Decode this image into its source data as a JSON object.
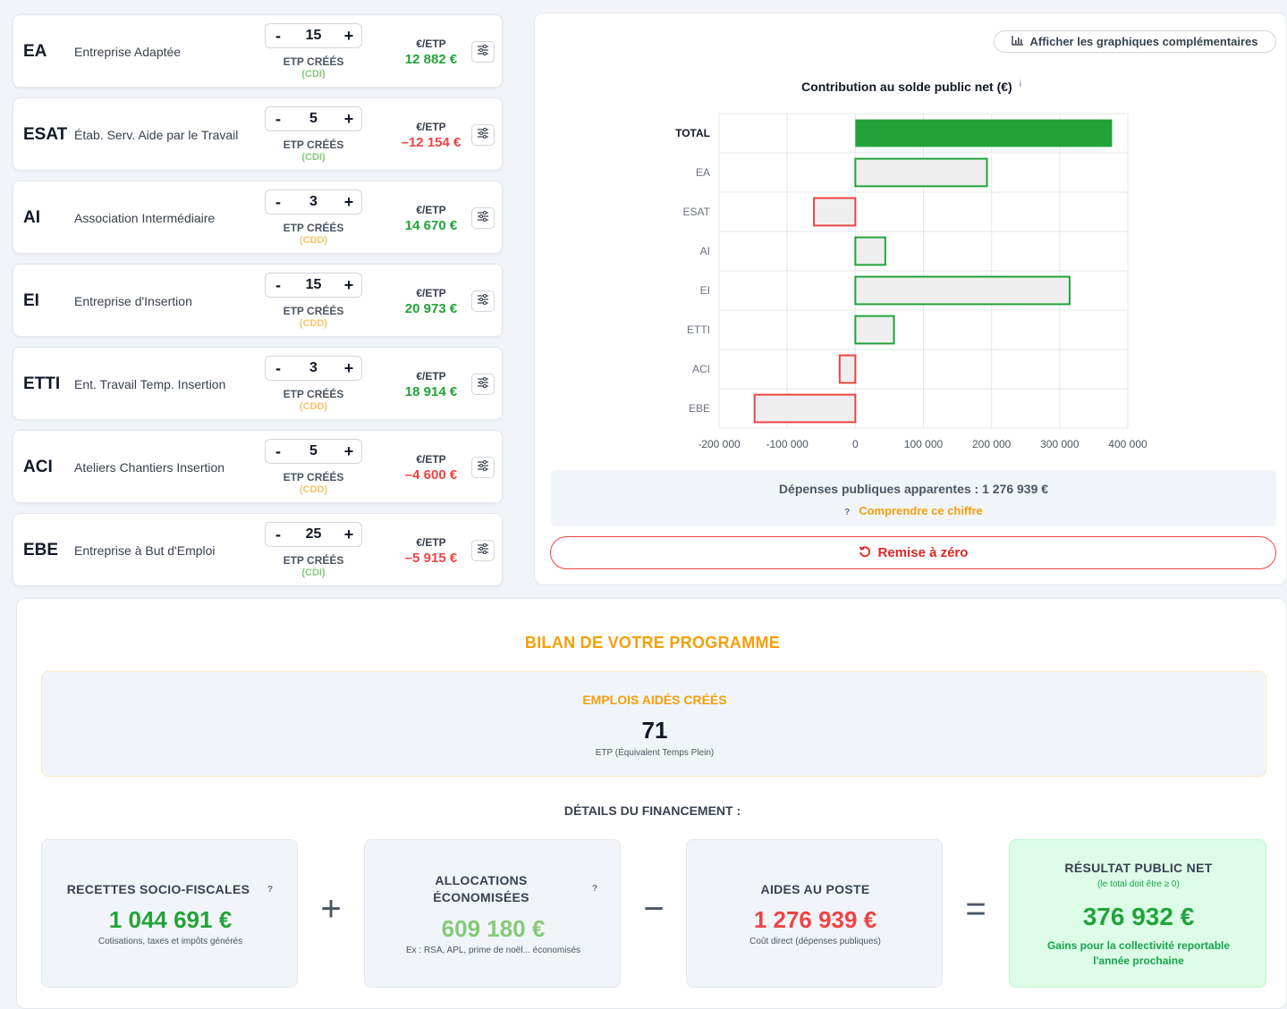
{
  "programs": [
    {
      "abbr": "EA",
      "name": "Entreprise Adaptée",
      "count": "15",
      "etp_label": "ETP CRÉÉS",
      "contract": "(CDI)",
      "per_label": "€/ETP",
      "per_value": "12 882 €",
      "positive": true
    },
    {
      "abbr": "ESAT",
      "name": "Étab. Serv. Aide par le Travail",
      "count": "5",
      "etp_label": "ETP CRÉÉS",
      "contract": "(CDI)",
      "per_label": "€/ETP",
      "per_value": "–12 154 €",
      "positive": false
    },
    {
      "abbr": "AI",
      "name": "Association Intermédiaire",
      "count": "3",
      "etp_label": "ETP CRÉÉS",
      "contract": "(CDD)",
      "per_label": "€/ETP",
      "per_value": "14 670 €",
      "positive": true
    },
    {
      "abbr": "EI",
      "name": "Entreprise d'Insertion",
      "count": "15",
      "etp_label": "ETP CRÉÉS",
      "contract": "(CDD)",
      "per_label": "€/ETP",
      "per_value": "20 973 €",
      "positive": true
    },
    {
      "abbr": "ETTI",
      "name": "Ent. Travail Temp. Insertion",
      "count": "3",
      "etp_label": "ETP CRÉÉS",
      "contract": "(CDD)",
      "per_label": "€/ETP",
      "per_value": "18 914 €",
      "positive": true
    },
    {
      "abbr": "ACI",
      "name": "Ateliers Chantiers Insertion",
      "count": "5",
      "etp_label": "ETP CRÉÉS",
      "contract": "(CDD)",
      "per_label": "€/ETP",
      "per_value": "–4 600 €",
      "positive": false
    },
    {
      "abbr": "EBE",
      "name": "Entreprise à But d'Emploi",
      "count": "25",
      "etp_label": "ETP CRÉÉS",
      "contract": "(CDI)",
      "per_label": "€/ETP",
      "per_value": "–5 915 €",
      "positive": false
    }
  ],
  "stepper": {
    "minus": "-",
    "plus": "+"
  },
  "colors": {
    "positive": "#22a33a",
    "negative": "#ef4444",
    "cdi": "#86c97a",
    "cdd": "#f5c36b",
    "accent": "#f59e0b",
    "bar_total": "#22a33a",
    "bar_fill": "#eeeeee"
  },
  "chart_panel": {
    "graph_toggle": "Afficher les graphiques complémentaires",
    "title": "Contribution au solde public net (€)",
    "info": "i",
    "depenses": "Dépenses publiques apparentes : 1 276 939 €",
    "help_mark": "?",
    "comprendre": "Comprendre ce chiffre",
    "reset": "Remise à zéro"
  },
  "chart_data": {
    "type": "bar",
    "orientation": "horizontal",
    "title": "Contribution au solde public net (€)",
    "categories": [
      "TOTAL",
      "EA",
      "ESAT",
      "AI",
      "EI",
      "ETTI",
      "ACI",
      "EBE"
    ],
    "values": [
      376932,
      193230,
      -60770,
      44010,
      314595,
      56742,
      -23000,
      -147875
    ],
    "xlim": [
      -200000,
      400000
    ],
    "xticks": [
      -200000,
      -100000,
      0,
      100000,
      200000,
      300000,
      400000
    ],
    "xtick_labels": [
      "-200 000",
      "-100 000",
      "0",
      "100 000",
      "200 000",
      "300 000",
      "400 000"
    ],
    "grid": true,
    "legend": "none"
  },
  "bilan": {
    "title": "BILAN DE VOTRE PROGRAMME",
    "emplois_label": "EMPLOIS AIDÉS CRÉÉS",
    "emplois_value": "71",
    "emplois_sub": "ETP (Équivalent Temps Plein)",
    "details_title": "DÉTAILS DU FINANCEMENT :",
    "recettes": {
      "label": "RECETTES SOCIO-FISCALES",
      "help": "?",
      "value": "1 044 691 €",
      "sub": "Cotisations, taxes et impôts générés"
    },
    "allocations": {
      "label_line1": "ALLOCATIONS",
      "label_line2": "ÉCONOMISÉES",
      "help": "?",
      "value": "609 180 €",
      "sub": "Ex : RSA, APL, prime de noël... économisés"
    },
    "aides": {
      "label": "AIDES AU POSTE",
      "value": "1 276 939 €",
      "sub": "Coût direct (dépenses publiques)"
    },
    "resultat": {
      "label": "RÉSULTAT PUBLIC NET",
      "note": "(le total doit être ≥ 0)",
      "value": "376 932 €",
      "sub_line1": "Gains pour la collectivité reportable",
      "sub_line2": "l'année prochaine"
    },
    "op_plus": "+",
    "op_minus": "−",
    "op_equals": "="
  }
}
